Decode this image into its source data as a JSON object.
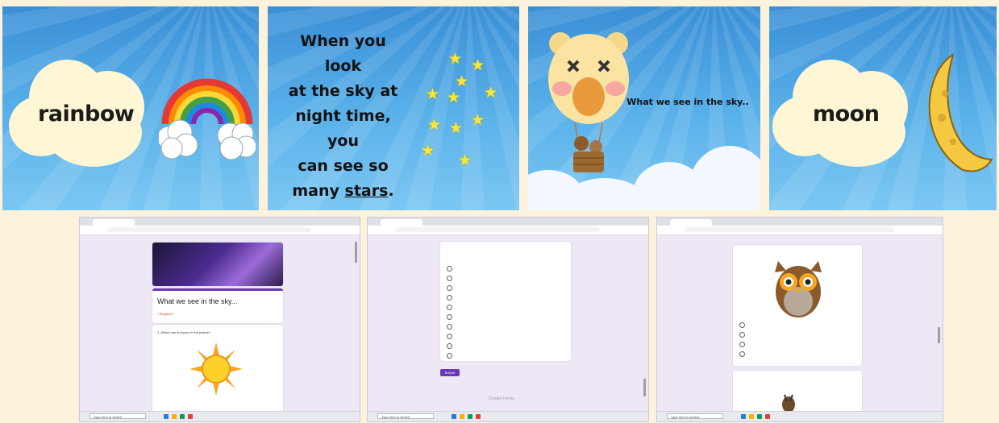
{
  "slides": [
    {
      "word": "rainbow"
    },
    {
      "text_lines": [
        "When you look",
        "at the sky at",
        "night time, you",
        "can see so",
        "many"
      ],
      "emphasis": "stars",
      "emphasis_suffix": "."
    },
    {
      "caption": "What we see in the sky.."
    },
    {
      "word": "moon"
    }
  ],
  "screens": {
    "form_title": "What we see in the sky...",
    "required_note": "* Required",
    "q1_text": "1. Which one is shown in the picture?",
    "submit_label": "Submit",
    "footer_brand": "Google Forms",
    "taskbar_search": "Type here to search"
  },
  "colors": {
    "sky": "#5ab2ea",
    "cloud": "#fff6d6",
    "star": "#f6e93b",
    "form_bg": "#ede7f6",
    "accent": "#673ab7"
  }
}
